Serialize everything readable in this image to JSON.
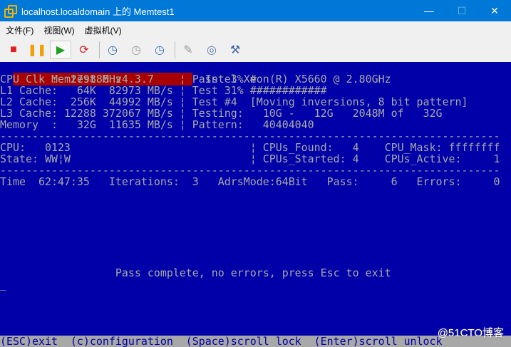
{
  "window": {
    "title": "localhost.localdomain 上的 Memtest1",
    "minimize": "—",
    "maximize": "☐",
    "close": "✕"
  },
  "menu": [
    "文件(F)",
    "视图(W)",
    "虚拟机(V)"
  ],
  "toolbar": [
    {
      "name": "stop",
      "glyph": "■",
      "color": "#e02020"
    },
    {
      "name": "pause",
      "glyph": "❚❚",
      "color": "#f0a000"
    },
    {
      "name": "play",
      "glyph": "▶",
      "color": "#20a020"
    },
    {
      "name": "reset",
      "glyph": "⟳",
      "color": "#d02020"
    },
    {
      "name": "snapshot",
      "glyph": "◷",
      "color": "#3070c0"
    },
    {
      "name": "revert-snapshot",
      "glyph": "◷",
      "color": "#999999"
    },
    {
      "name": "manage-snapshots",
      "glyph": "◷",
      "color": "#3070c0"
    },
    {
      "name": "floppy-settings",
      "glyph": "✎",
      "color": "#999999"
    },
    {
      "name": "cd-settings",
      "glyph": "◎",
      "color": "#6080b0"
    },
    {
      "name": "usb-settings",
      "glyph": "⚒",
      "color": "#4060a0"
    }
  ],
  "console": {
    "header": "      Memtest86 v4.3.7      ",
    "cpu_model": "  Intel Xeon(R) X5660 @ 2.80GHz",
    "lines": [
      "CPU Clk :  2798 MHz         ¦ Pass  3% #",
      "L1 Cache:   64K  82973 MB/s ¦ Test 31% ############",
      "L2 Cache:  256K  44992 MB/s ¦ Test #4  [Moving inversions, 8 bit pattern]",
      "L3 Cache: 12288 372067 MB/s ¦ Testing:   10G -   12G   2048M of   32G",
      "Memory  :   32G  11635 MB/s ¦ Pattern:   40404040",
      "------------------------------------------------------------------------------",
      "CPU:   0123                            ¦ CPUs_Found:   4    CPU_Mask: ffffffff",
      "State: WW¦W                            ¦ CPUs_Started: 4    CPUs_Active:     1",
      "------------------------------------------------------------------------------",
      "Time  62:47:35   Iterations:  3   AdrsMode:64Bit   Pass:     6   Errors:     0"
    ],
    "message": "                  Pass complete, no errors, press Esc to exit",
    "cursor": "_",
    "footer": "(ESC)exit  (c)configuration  (Space)scroll_lock  (Enter)scroll_unlock"
  },
  "watermark": "@51CTO博客"
}
